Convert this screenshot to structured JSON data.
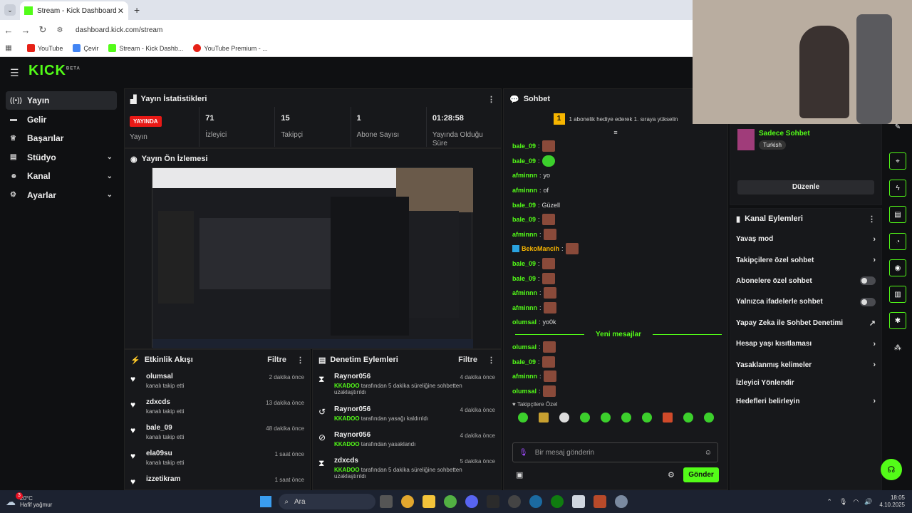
{
  "browser": {
    "tab_title": "Stream - Kick Dashboard",
    "url": "dashboard.kick.com/stream",
    "bookmarks": [
      "YouTube",
      "Çevir",
      "Stream - Kick Dashb...",
      "YouTube Premium - ..."
    ]
  },
  "brand": {
    "logo": "KICK",
    "beta": "BETA",
    "accent": "#53fc18"
  },
  "sidebar": {
    "items": [
      {
        "label": "Yayın",
        "icon": "broadcast-icon"
      },
      {
        "label": "Gelir",
        "icon": "wallet-icon"
      },
      {
        "label": "Başarılar",
        "icon": "trophy-icon"
      },
      {
        "label": "Stüdyo",
        "icon": "studio-icon"
      },
      {
        "label": "Kanal",
        "icon": "people-icon"
      },
      {
        "label": "Ayarlar",
        "icon": "gear-icon"
      }
    ]
  },
  "stats_panel": {
    "title": "Yayın İstatistikleri",
    "live_badge": "YAYINDA",
    "live_label": "Yayın",
    "stats": [
      {
        "value": "71",
        "label": "İzleyici"
      },
      {
        "value": "15",
        "label": "Takipçi"
      },
      {
        "value": "1",
        "label": "Abone Sayısı"
      },
      {
        "value": "01:28:58",
        "label": "Yayında Olduğu Süre"
      }
    ]
  },
  "preview_panel": {
    "title": "Yayın Ön İzlemesi"
  },
  "activity_panel": {
    "title": "Etkinlik Akışı",
    "filter": "Filtre",
    "rows": [
      {
        "name": "olumsal",
        "sub": "kanalı takip etti",
        "time": "2 dakika önce"
      },
      {
        "name": "zdxcds",
        "sub": "kanalı takip etti",
        "time": "13 dakika önce"
      },
      {
        "name": "bale_09",
        "sub": "kanalı takip etti",
        "time": "48 dakika önce"
      },
      {
        "name": "ela09su",
        "sub": "kanalı takip etti",
        "time": "1 saat önce"
      },
      {
        "name": "izzetikram",
        "sub": "",
        "time": "1 saat önce"
      }
    ]
  },
  "mod_panel": {
    "title": "Denetim Eylemleri",
    "filter": "Filtre",
    "rows": [
      {
        "name": "Raynor056",
        "mod": "KKADOO",
        "sub": "tarafından 5 dakika süreliğine sohbetten uzaklaştırıldı",
        "time": "4 dakika önce",
        "icon": "hourglass-icon"
      },
      {
        "name": "Raynor056",
        "mod": "KKADOO",
        "sub": "tarafından yasağı kaldırıldı",
        "time": "4 dakika önce",
        "icon": "undo-icon"
      },
      {
        "name": "Raynor056",
        "mod": "KKADOO",
        "sub": "tarafından yasaklandı",
        "time": "4 dakika önce",
        "icon": "ban-icon"
      },
      {
        "name": "zdxcds",
        "mod": "KKADOO",
        "sub": "tarafından 5 dakika süreliğine sohbetten uzaklaştırıldı",
        "time": "5 dakika önce",
        "icon": "hourglass-icon"
      }
    ]
  },
  "chat_panel": {
    "title": "Sohbet",
    "pinned": "1 abonelik hediye ederek 1. sıraya yükselin",
    "pinned_rank": "1",
    "messages": [
      {
        "user": "bale_09",
        "text": "",
        "emote": "face"
      },
      {
        "user": "bale_09",
        "text": "",
        "emote": "green"
      },
      {
        "user": "afminnn",
        "text": "yo",
        "emote": ""
      },
      {
        "user": "afminnn",
        "text": "of",
        "emote": ""
      },
      {
        "user": "bale_09",
        "text": "Güzell",
        "emote": ""
      },
      {
        "user": "bale_09",
        "text": "",
        "emote": "face"
      },
      {
        "user": "afminnn",
        "text": "",
        "emote": "face"
      },
      {
        "user": "BekoMancih",
        "text": "",
        "emote": "face",
        "color": "orange"
      },
      {
        "user": "bale_09",
        "text": "",
        "emote": "face"
      },
      {
        "user": "bale_09",
        "text": "",
        "emote": "face"
      },
      {
        "user": "afminnn",
        "text": "",
        "emote": "face"
      },
      {
        "user": "afminnn",
        "text": "",
        "emote": "face"
      },
      {
        "user": "olumsal",
        "text": "yo0k",
        "emote": ""
      }
    ],
    "new_messages": "Yeni mesajlar",
    "messages_after": [
      {
        "user": "olumsal",
        "text": "",
        "emote": "face"
      },
      {
        "user": "bale_09",
        "text": "",
        "emote": "face"
      },
      {
        "user": "afminnn",
        "text": "",
        "emote": "face"
      },
      {
        "user": "olumsal",
        "text": "",
        "emote": "face"
      }
    ],
    "followers_only": "Takipçilere Özel",
    "input_placeholder": "Bir mesaj gönderin",
    "send": "Gönder"
  },
  "right_panel": {
    "mode_title": "Sadece Sohbet",
    "mode_tag": "Turkish",
    "edit": "Düzenle",
    "actions_title": "Kanal Eylemleri",
    "actions": [
      {
        "label": "Yavaş mod",
        "control": "arrow"
      },
      {
        "label": "Takipçilere özel sohbet",
        "control": "arrow"
      },
      {
        "label": "Abonelere özel sohbet",
        "control": "toggle"
      },
      {
        "label": "Yalnızca ifadelerle sohbet",
        "control": "toggle"
      },
      {
        "label": "Yapay Zeka ile Sohbet Denetimi",
        "control": "external"
      },
      {
        "label": "Hesap yaşı kısıtlaması",
        "control": "arrow"
      },
      {
        "label": "Yasaklanmış kelimeler",
        "control": "arrow"
      },
      {
        "label": "İzleyici Yönlendir",
        "control": "none"
      },
      {
        "label": "Hedefleri belirleyin",
        "control": "arrow"
      }
    ]
  },
  "taskbar": {
    "weather_temp": "20°C",
    "weather_desc": "Hafif yağmur",
    "weather_badge": "3",
    "search": "Ara",
    "time": "18:05",
    "date": "4.10.2025"
  }
}
